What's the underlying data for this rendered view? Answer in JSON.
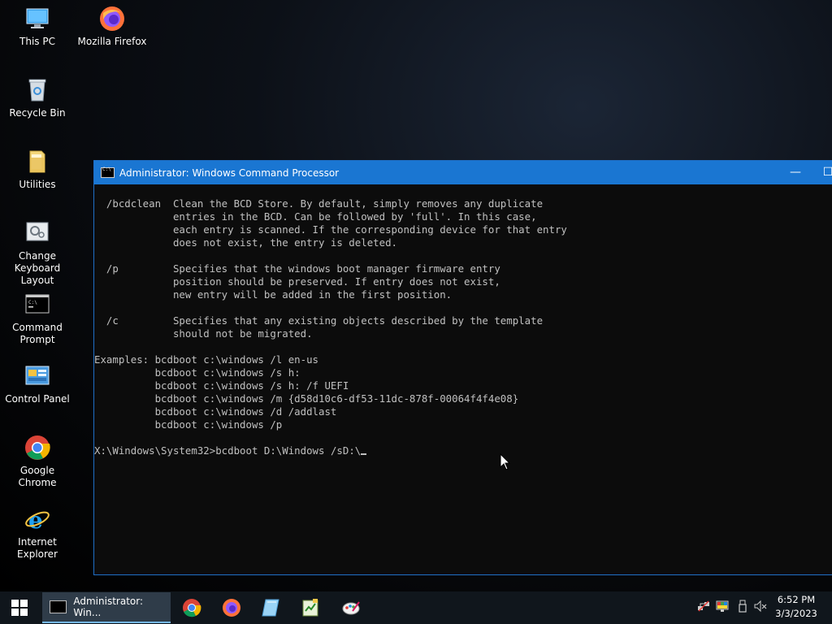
{
  "desktop": {
    "icons": [
      {
        "label_1": "This PC",
        "label_2": ""
      },
      {
        "label_1": "Mozilla Firefox",
        "label_2": ""
      },
      {
        "label_1": "Recycle Bin",
        "label_2": ""
      },
      {
        "label_1": "Utilities",
        "label_2": ""
      },
      {
        "label_1": "Change",
        "label_2": "Keyboard Layout"
      },
      {
        "label_1": "Command",
        "label_2": "Prompt"
      },
      {
        "label_1": "Control Panel",
        "label_2": ""
      },
      {
        "label_1": "Google Chrome",
        "label_2": ""
      },
      {
        "label_1": "Internet Explorer",
        "label_2": ""
      }
    ]
  },
  "window": {
    "title": "Administrator: Windows Command Processor",
    "minimize_glyph": "—",
    "maximize_glyph": "☐"
  },
  "console": {
    "lines": [
      "  /bcdclean  Clean the BCD Store. By default, simply removes any duplicate",
      "             entries in the BCD. Can be followed by 'full'. In this case,",
      "             each entry is scanned. If the corresponding device for that entry",
      "             does not exist, the entry is deleted.",
      "",
      "  /p         Specifies that the windows boot manager firmware entry",
      "             position should be preserved. If entry does not exist,",
      "             new entry will be added in the first position.",
      "",
      "  /c         Specifies that any existing objects described by the template",
      "             should not be migrated.",
      "",
      "Examples: bcdboot c:\\windows /l en-us",
      "          bcdboot c:\\windows /s h:",
      "          bcdboot c:\\windows /s h: /f UEFI",
      "          bcdboot c:\\windows /m {d58d10c6-df53-11dc-878f-00064f4f4e08}",
      "          bcdboot c:\\windows /d /addlast",
      "          bcdboot c:\\windows /p",
      ""
    ],
    "prompt": "X:\\Windows\\System32>",
    "input": "bcdboot D:\\Windows /sD:\\"
  },
  "taskbar": {
    "active_task_label": "Administrator: Win...",
    "pinned": [
      "chrome-icon",
      "firefox-icon",
      "notepad-icon",
      "spreadsheet-icon",
      "paint-icon"
    ],
    "clock_time": "6:52 PM",
    "clock_date": "3/3/2023"
  },
  "colors": {
    "title_bar": "#1a76d2",
    "console_text": "#c0c0c0",
    "console_bg": "#0c0c0c",
    "taskbar": "#10161c"
  }
}
